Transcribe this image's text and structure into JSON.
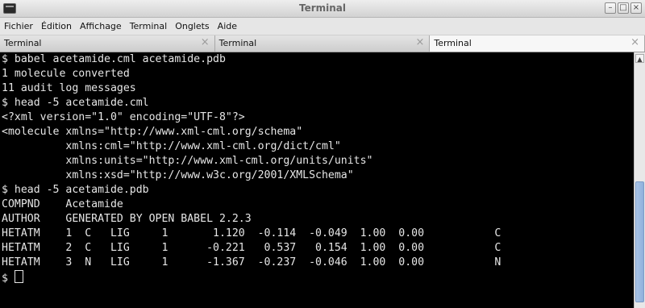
{
  "window": {
    "title": "Terminal",
    "buttons": {
      "minimize": "–",
      "maximize": "□",
      "close": "×"
    }
  },
  "menu": [
    "Fichier",
    "Édition",
    "Affichage",
    "Terminal",
    "Onglets",
    "Aide"
  ],
  "tabs": [
    {
      "label": "Terminal",
      "close": "×"
    },
    {
      "label": "Terminal",
      "close": "×"
    },
    {
      "label": "Terminal",
      "close": "×"
    }
  ],
  "active_tab": 2,
  "terminal": {
    "lines": [
      "$ babel acetamide.cml acetamide.pdb",
      "1 molecule converted",
      "11 audit log messages",
      "$ head -5 acetamide.cml",
      "<?xml version=\"1.0\" encoding=\"UTF-8\"?>",
      "<molecule xmlns=\"http://www.xml-cml.org/schema\"",
      "          xmlns:cml=\"http://www.xml-cml.org/dict/cml\"",
      "          xmlns:units=\"http://www.xml-cml.org/units/units\"",
      "          xmlns:xsd=\"http://www.w3c.org/2001/XMLSchema\"",
      "$ head -5 acetamide.pdb",
      "COMPND    Acetamide",
      "AUTHOR    GENERATED BY OPEN BABEL 2.2.3",
      "HETATM    1  C   LIG     1       1.120  -0.114  -0.049  1.00  0.00           C",
      "HETATM    2  C   LIG     1      -0.221   0.537   0.154  1.00  0.00           C",
      "HETATM    3  N   LIG     1      -1.367  -0.237  -0.046  1.00  0.00           N"
    ],
    "prompt": "$ "
  },
  "scrollbar": {
    "up_arrow": "▲"
  }
}
